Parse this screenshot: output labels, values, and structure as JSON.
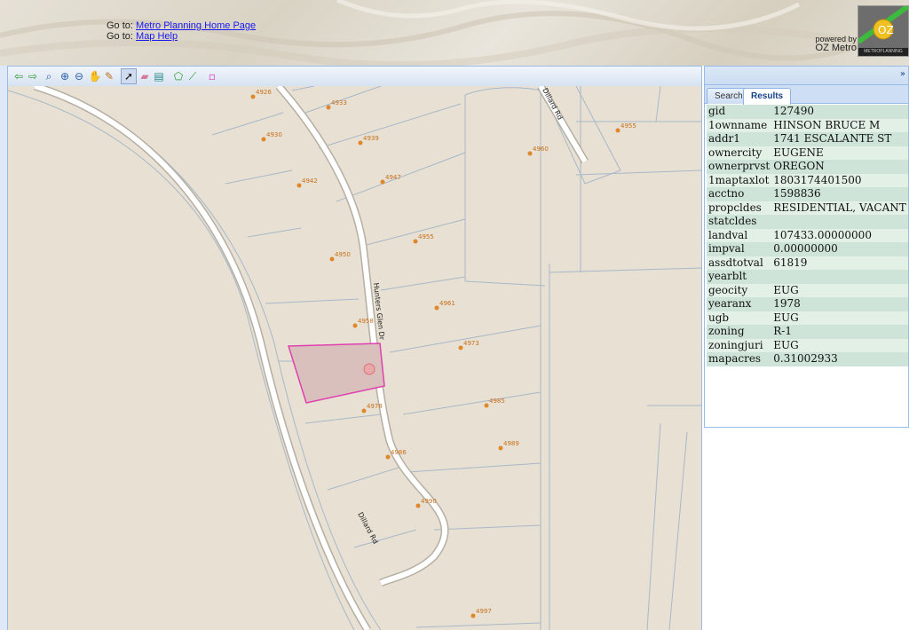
{
  "header": {
    "links": [
      {
        "prefix": "Go to:",
        "label": "Metro Planning Home Page"
      },
      {
        "prefix": "Go to:",
        "label": "Map Help"
      }
    ],
    "powered_by": "powered by",
    "powered_name": "OZ Metro",
    "logo_text": "OZ",
    "logo_band": "METROPLANNING"
  },
  "toolbar": {
    "tools": [
      {
        "name": "back-arrow-icon",
        "glyph": "⇦",
        "color": "#2e9c2e"
      },
      {
        "name": "forward-arrow-icon",
        "glyph": "⇨",
        "color": "#2e9c2e"
      },
      {
        "name": "zoom-extent-icon",
        "glyph": "⌕",
        "color": "#2d5fa8"
      },
      {
        "name": "zoom-in-icon",
        "glyph": "⊕",
        "color": "#2d5fa8"
      },
      {
        "name": "zoom-out-icon",
        "glyph": "⊖",
        "color": "#2d5fa8"
      },
      {
        "name": "pan-hand-icon",
        "glyph": "✋",
        "color": "#b08040"
      },
      {
        "name": "measure-ruler-icon",
        "glyph": "✎",
        "color": "#c0701f"
      },
      {
        "name": "select-pointer-icon",
        "glyph": "➚",
        "color": "#111111"
      },
      {
        "name": "eraser-icon",
        "glyph": "▰",
        "color": "#d57c9a"
      },
      {
        "name": "identify-icon",
        "glyph": "▤",
        "color": "#2b8a8a"
      },
      {
        "name": "draw-polygon-icon",
        "glyph": "⬠",
        "color": "#2e9c2e"
      },
      {
        "name": "draw-line-icon",
        "glyph": "⟋",
        "color": "#2e9c2e"
      },
      {
        "name": "draw-point-icon",
        "glyph": "▫",
        "color": "#e040c0"
      }
    ]
  },
  "map": {
    "colors": {
      "land": "#e7e0d3",
      "parcel_line": "#a8b8c8",
      "road_fill": "#ffffff",
      "road_edge": "#b5aea3",
      "selection": "#e040b0",
      "address": "#e0872a"
    },
    "roads": [
      "Hunters Glen Dr",
      "Dillard Rd",
      "Dillard Rd"
    ],
    "addresses": [
      "4926",
      "4933",
      "4930",
      "4939",
      "4942",
      "4947",
      "4960",
      "4955",
      "4950",
      "4955",
      "4961",
      "4958",
      "4973",
      "4978",
      "4985",
      "4986",
      "4989",
      "4990",
      "4997"
    ]
  },
  "panel": {
    "collapse_glyph": "»",
    "tabs": [
      "Search",
      "Results"
    ],
    "active_tab": "Results",
    "rows": [
      {
        "key": "gid",
        "value": "127490"
      },
      {
        "key": "1ownname",
        "value": "HINSON BRUCE M"
      },
      {
        "key": "addr1",
        "value": "1741 ESCALANTE ST"
      },
      {
        "key": "ownercity",
        "value": "EUGENE"
      },
      {
        "key": "ownerprvst",
        "value": "OREGON"
      },
      {
        "key": "1maptaxlot",
        "value": "1803174401500"
      },
      {
        "key": "acctno",
        "value": "1598836"
      },
      {
        "key": "propcldes",
        "value": "RESIDENTIAL, VACANT"
      },
      {
        "key": "statcldes",
        "value": ""
      },
      {
        "key": "landval",
        "value": "107433.00000000"
      },
      {
        "key": "impval",
        "value": "0.00000000"
      },
      {
        "key": "assdtotval",
        "value": "61819"
      },
      {
        "key": "yearblt",
        "value": ""
      },
      {
        "key": "geocity",
        "value": "EUG"
      },
      {
        "key": "yearanx",
        "value": "1978"
      },
      {
        "key": "ugb",
        "value": "EUG"
      },
      {
        "key": "zoning",
        "value": "R-1"
      },
      {
        "key": "zoningjuri",
        "value": "EUG"
      },
      {
        "key": "mapacres",
        "value": "0.31002933"
      }
    ]
  }
}
